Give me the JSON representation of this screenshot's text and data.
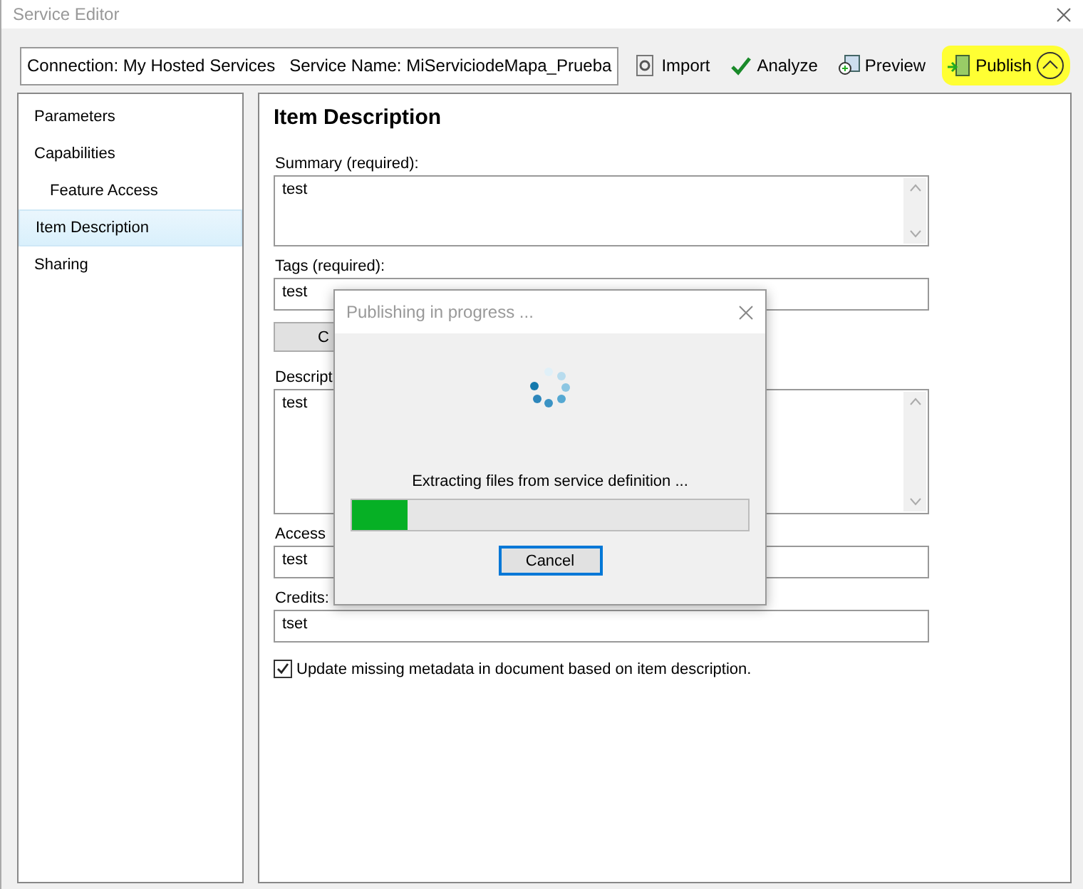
{
  "window": {
    "title": "Service Editor"
  },
  "toolbar": {
    "connection": "Connection: My Hosted Services   Service Name: MiServiciodeMapa_Prueba",
    "buttons": [
      {
        "label": "Import",
        "kind": "import",
        "highlighted": false
      },
      {
        "label": "Analyze",
        "kind": "analyze",
        "highlighted": false
      },
      {
        "label": "Preview",
        "kind": "preview",
        "highlighted": false
      },
      {
        "label": "Publish",
        "kind": "publish",
        "highlighted": true
      }
    ]
  },
  "sidebar": {
    "items": [
      {
        "label": "Parameters",
        "selected": false
      },
      {
        "label": "Capabilities",
        "selected": false,
        "children": [
          {
            "label": "Feature Access",
            "selected": false
          }
        ]
      },
      {
        "label": "Item Description",
        "selected": true
      },
      {
        "label": "Sharing",
        "selected": false
      }
    ]
  },
  "form": {
    "heading": "Item Description",
    "fields": [
      {
        "kind": "textarea",
        "label": "Summary (required):",
        "value": "test"
      },
      {
        "kind": "input",
        "label": "Tags (required):",
        "value": "test"
      },
      {
        "kind": "button",
        "label": "C"
      },
      {
        "kind": "textarea",
        "label": "Descript",
        "value": "test"
      },
      {
        "kind": "input",
        "label": "Access",
        "value": "test"
      },
      {
        "kind": "input",
        "label": "Credits:",
        "value": "tset"
      }
    ],
    "checkbox": {
      "label": "Update missing metadata in document based on item description.",
      "checked": true
    }
  },
  "dialog": {
    "title": "Publishing in progress ...",
    "message": "Extracting files from service definition ...",
    "progress": {
      "level": 0.14
    },
    "button": "Cancel"
  }
}
